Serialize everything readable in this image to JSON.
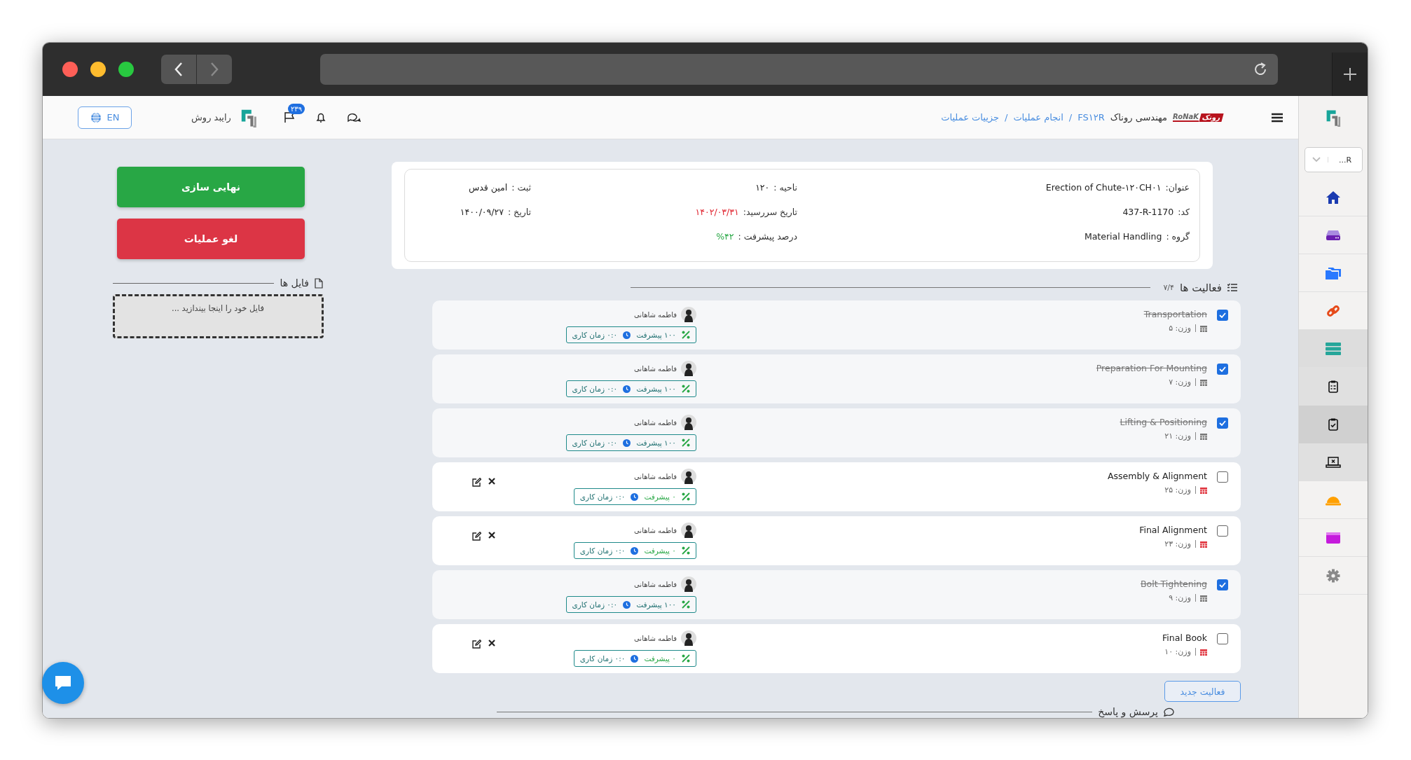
{
  "browser": {
    "forward_enabled": false
  },
  "header": {
    "brand": {
      "logo_persian": "رونک",
      "logo_latin": "RoNaK",
      "company": "مهندسی روناک"
    },
    "breadcrumb": [
      "FS۱۲R",
      "انجام عملیات",
      "جزییات عملیات"
    ],
    "breadcrumb_separator": "/",
    "flag_badge": "۲۳۹",
    "app_name": "رایبد روش",
    "language": "EN"
  },
  "info": {
    "columns": [
      [
        {
          "label": "عنوان:",
          "value": "Erection of Chute-۱۲۰CH۰۱",
          "color": "#222222"
        },
        {
          "label": "کد:",
          "value": "437-R-1170",
          "color": "#222222"
        },
        {
          "label": "گروه :",
          "value": "Material Handling",
          "color": "#222222"
        }
      ],
      [
        {
          "label": "ناحیه :",
          "value": "۱۲۰",
          "color": "#222222"
        },
        {
          "label": "تاریخ سررسید:",
          "value": "۱۴۰۲/۰۳/۳۱",
          "color": "#e0242f"
        },
        {
          "label": "درصد پیشرفت :",
          "value": "%۴۲",
          "color": "#28a745"
        }
      ],
      [
        {
          "label": "ثبت :",
          "value": "امین قدس",
          "color": "#222222"
        },
        {
          "label": "تاریخ :",
          "value": "۱۴۰۰/۰۹/۲۷",
          "color": "#222222"
        }
      ]
    ]
  },
  "activities": {
    "title": "فعالیت ها",
    "count": "۷/۴",
    "items": [
      {
        "title": "Transportation",
        "checked": true,
        "weight": "وزن: ۵",
        "assignee": "فاطمه شاهانی",
        "progress": "۱۰۰ پیشرفت",
        "work_time": "۰:۰ زمان کاری"
      },
      {
        "title": "Preparation For Mounting",
        "checked": true,
        "weight": "وزن: ۷",
        "assignee": "فاطمه شاهانی",
        "progress": "۱۰۰ پیشرفت",
        "work_time": "۰:۰ زمان کاری"
      },
      {
        "title": "Lifting & Positioning",
        "checked": true,
        "weight": "وزن: ۲۱",
        "assignee": "فاطمه شاهانی",
        "progress": "۱۰۰ پیشرفت",
        "work_time": "۰:۰ زمان کاری"
      },
      {
        "title": "Assembly & Alignment",
        "checked": false,
        "weight": "وزن: ۲۵",
        "assignee": "فاطمه شاهانی",
        "progress": "۰ پیشرفت",
        "work_time": "۰:۰ زمان کاری"
      },
      {
        "title": "Final Alignment",
        "checked": false,
        "weight": "وزن: ۲۳",
        "assignee": "فاطمه شاهانی",
        "progress": "۰ پیشرفت",
        "work_time": "۰:۰ زمان کاری"
      },
      {
        "title": "Bolt Tightening",
        "checked": true,
        "weight": "وزن: ۹",
        "assignee": "فاطمه شاهانی",
        "progress": "۱۰۰ پیشرفت",
        "work_time": "۰:۰ زمان کاری"
      },
      {
        "title": "Final Book",
        "checked": false,
        "weight": "وزن: ۱۰",
        "assignee": "فاطمه شاهانی",
        "progress": "۰ پیشرفت",
        "work_time": "۰:۰ زمان کاری"
      }
    ],
    "new_button": "فعالیت جدید"
  },
  "qa": {
    "title": "پرسش و پاسخ"
  },
  "actions": {
    "finalize": "نهایی سازی",
    "cancel": "لغو عملیات"
  },
  "files": {
    "title": "فایل ها",
    "dropzone_text": "فایل خود را اینجا بیندازید ..."
  },
  "sidebar": {
    "selector_value": "...R",
    "items": [
      {
        "selected": false
      },
      {
        "selected": false
      },
      {
        "selected": false
      },
      {
        "selected": false
      },
      {
        "selected": false,
        "expanded": true,
        "children": [
          {
            "selected": false
          },
          {
            "selected": true
          },
          {
            "selected": false
          }
        ]
      },
      {
        "selected": false
      },
      {
        "selected": false
      },
      {
        "selected": false
      }
    ]
  }
}
